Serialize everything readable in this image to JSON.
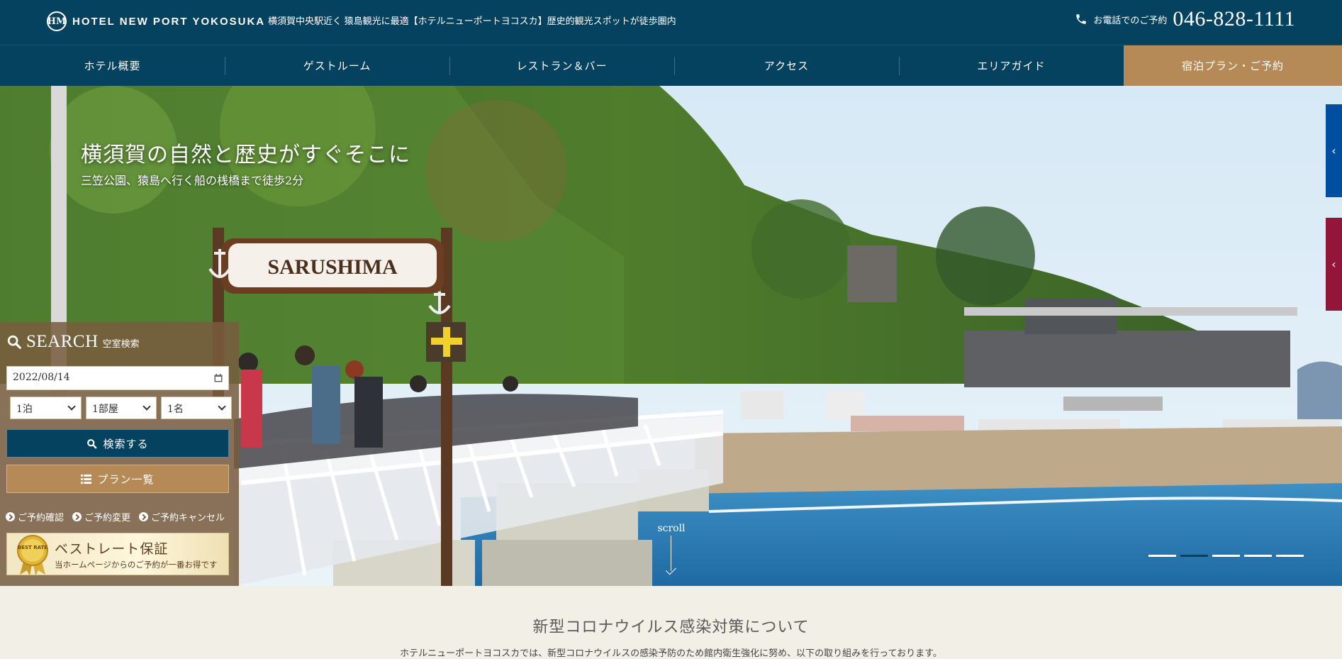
{
  "header": {
    "logo_mark": "HM",
    "logo_text": "HOTEL NEW PORT YOKOSUKA",
    "tagline": "横須賀中央駅近く 猿島観光に最適【ホテルニューポートヨコスカ】歴史的観光スポットが徒歩圏内",
    "phone_label": "お電話でのご予約",
    "phone_number": "046-828-1111"
  },
  "nav": {
    "items": [
      "ホテル概要",
      "ゲストルーム",
      "レストラン＆バー",
      "アクセス",
      "エリアガイド"
    ],
    "cta": "宿泊プラン・ご予約"
  },
  "hero": {
    "title": "横須賀の自然と歴史がすぐそこに",
    "subtitle": "三笠公園、猿島へ行く船の桟橋まで徒歩2分",
    "sign_text": "SARUSHIMA",
    "scroll_label": "scroll",
    "slide_count": 5,
    "active_slide": 2
  },
  "side_tabs": {
    "blue_arrow": "‹",
    "red_arrow": "‹"
  },
  "search": {
    "title": "SEARCH",
    "subtitle": "空室検索",
    "date": "2022/08/14",
    "nights": "1泊",
    "rooms": "1部屋",
    "guests": "1名",
    "search_button": "検索する",
    "plan_button": "プラン一覧",
    "links": [
      "ご予約確認",
      "ご予約変更",
      "ご予約キャンセル"
    ],
    "best_badge": "BEST RATE",
    "best_title": "ベストレート保証",
    "best_sub": "当ホームページからのご予約が一番お得です"
  },
  "notice": {
    "title": "新型コロナウイルス感染対策について",
    "body": "ホテルニューポートヨコスカでは、新型コロナウイルスの感染予防のため館内衛生強化に努め、以下の取り組みを行っております。"
  },
  "colors": {
    "navy": "#05425f",
    "gold": "#b68a56",
    "side_blue": "#004ea0",
    "side_red": "#93153a",
    "page_bg": "#f2efe6"
  }
}
